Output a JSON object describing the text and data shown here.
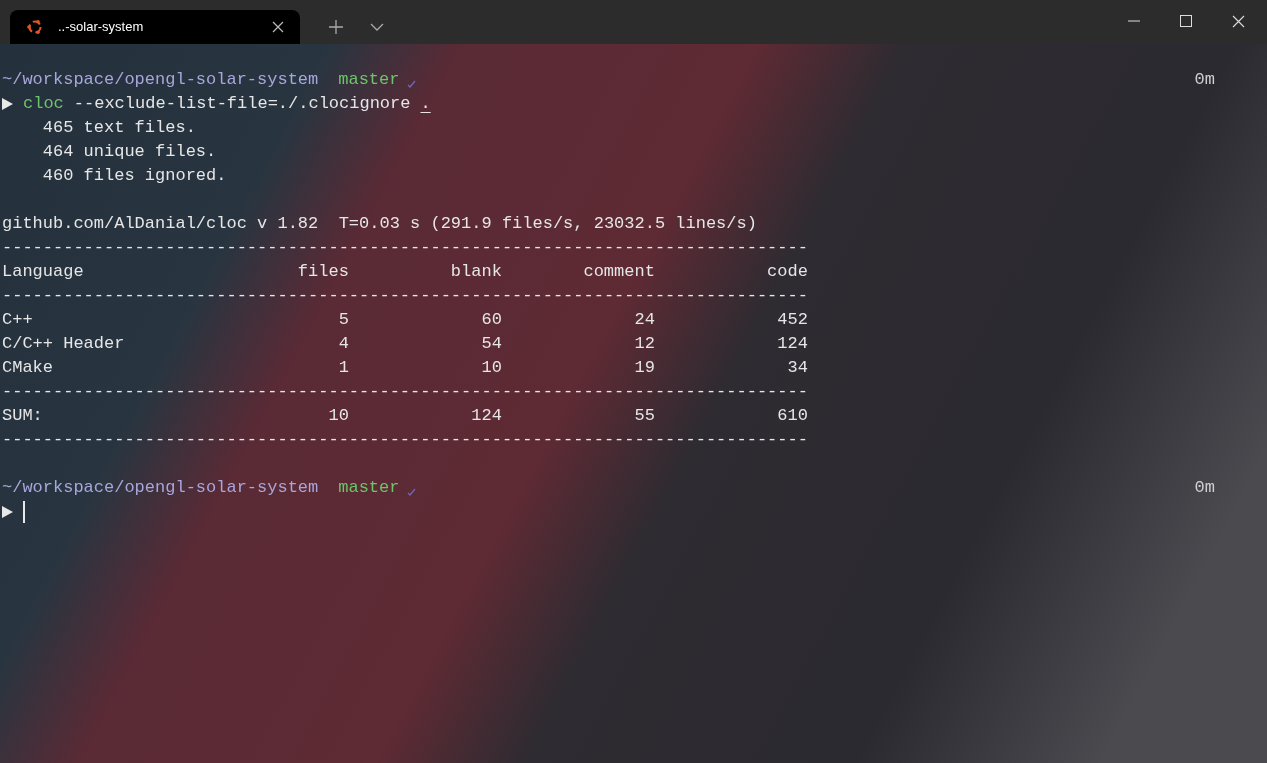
{
  "tabs": [
    {
      "title": "..-solar-system",
      "selected": true
    }
  ],
  "session": [
    {
      "kind": "prompt",
      "path": "~/workspace/opengl-solar-system",
      "branch": "master",
      "duration": "0m"
    },
    {
      "kind": "command",
      "program": "cloc",
      "args": "--exclude-list-file=./.clocignore",
      "target": "."
    },
    {
      "kind": "output",
      "text": "    465 text files."
    },
    {
      "kind": "output",
      "text": "    464 unique files."
    },
    {
      "kind": "output",
      "text": "    460 files ignored."
    },
    {
      "kind": "blank"
    },
    {
      "kind": "output",
      "text": "github.com/AlDanial/cloc v 1.82  T=0.03 s (291.9 files/s, 23032.5 lines/s)"
    },
    {
      "kind": "rule",
      "text": "-------------------------------------------------------------------------------"
    },
    {
      "kind": "row",
      "cells": [
        "Language",
        "files",
        "blank",
        "comment",
        "code"
      ]
    },
    {
      "kind": "rule",
      "text": "-------------------------------------------------------------------------------"
    },
    {
      "kind": "row",
      "cells": [
        "C++",
        "5",
        "60",
        "24",
        "452"
      ]
    },
    {
      "kind": "row",
      "cells": [
        "C/C++ Header",
        "4",
        "54",
        "12",
        "124"
      ]
    },
    {
      "kind": "row",
      "cells": [
        "CMake",
        "1",
        "10",
        "19",
        "34"
      ]
    },
    {
      "kind": "rule",
      "text": "-------------------------------------------------------------------------------"
    },
    {
      "kind": "row",
      "cells": [
        "SUM:",
        "10",
        "124",
        "55",
        "610"
      ]
    },
    {
      "kind": "rule",
      "text": "-------------------------------------------------------------------------------"
    },
    {
      "kind": "blank"
    },
    {
      "kind": "prompt",
      "path": "~/workspace/opengl-solar-system",
      "branch": "master",
      "duration": "0m"
    },
    {
      "kind": "input"
    }
  ]
}
